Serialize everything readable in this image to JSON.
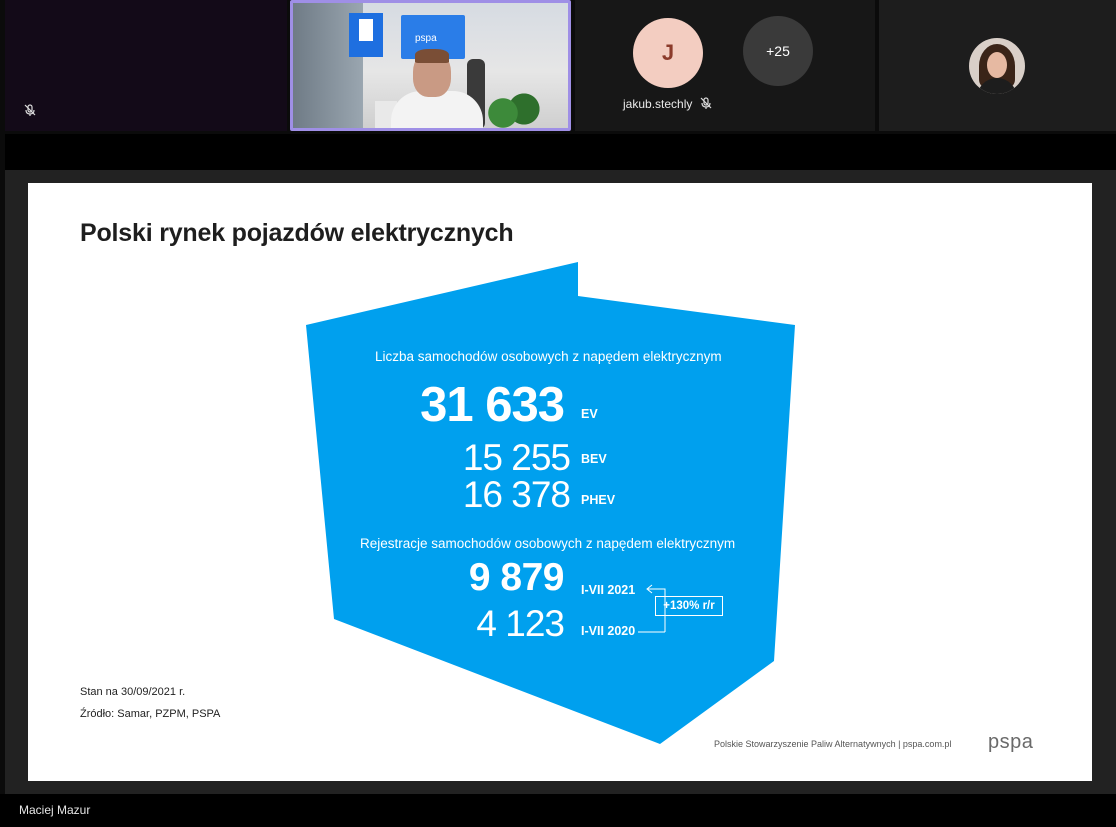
{
  "participants": {
    "tile_avatar_initial": "J",
    "tile_more_count": "+25",
    "tile_name": "jakub.stechly",
    "video_screen_logo": "pspa"
  },
  "slide": {
    "title": "Polski rynek pojazdów elektrycznych",
    "stock_heading": "Liczba samochodów osobowych z napędem elektrycznym",
    "ev_total": "31 633",
    "ev_label": "EV",
    "bev_value": "15 255",
    "bev_label": "BEV",
    "phev_value": "16 378",
    "phev_label": "PHEV",
    "registrations_heading": "Rejestracje samochodów osobowych z napędem elektrycznym",
    "reg_2021_value": "9 879",
    "reg_2021_label": "I-VII 2021",
    "reg_2020_value": "4 123",
    "reg_2020_label": "I-VII 2020",
    "growth": "+130% r/r",
    "note_date": "Stan na 30/09/2021 r.",
    "note_source": "Źródło: Samar, PZPM, PSPA",
    "footer_org": "Polskie Stowarzyszenie Paliw Alternatywnych  |  pspa.com.pl",
    "footer_logo": "pspa",
    "accent_color": "#00a0ee"
  },
  "presenter_name": "Maciej Mazur",
  "colors": {
    "active_speaker_border": "#9f8fe6",
    "avatar_bg": "#f3cdc1",
    "avatar_text": "#8b3b2b"
  }
}
